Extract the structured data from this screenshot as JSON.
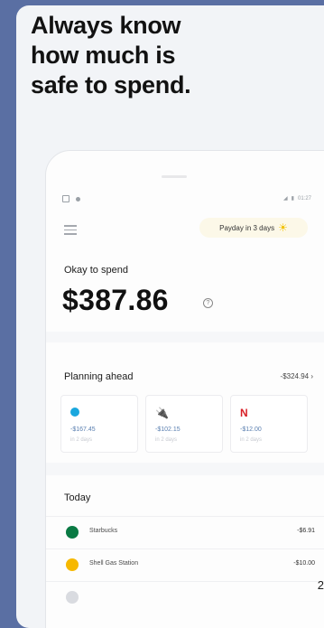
{
  "headline": {
    "line1": "Always know",
    "line2": "how much is",
    "line3": "safe to spend."
  },
  "statusbar": {
    "time": "01:27"
  },
  "payday": {
    "label": "Payday in 3 days"
  },
  "spend": {
    "label": "Okay to spend",
    "amount": "$387.86"
  },
  "planning": {
    "label": "Planning ahead",
    "total": "-$324.94 ›",
    "tiles": [
      {
        "icon": "att-icon",
        "amount": "-$167.45",
        "when": "in 2 days"
      },
      {
        "icon": "plug-icon",
        "amount": "-$102.15",
        "when": "in 2 days"
      },
      {
        "icon": "netflix-icon",
        "amount": "-$12.00",
        "when": "in 2 days"
      }
    ]
  },
  "today": {
    "label": "Today",
    "transactions": [
      {
        "name": "Starbucks",
        "amount": "-$6.91",
        "color": "#0a7a44"
      },
      {
        "name": "Shell Gas Station",
        "amount": "-$10.00",
        "color": "#f6b800"
      }
    ]
  },
  "page_number": "2",
  "colors": {
    "background": "#5a6fa3",
    "accent_text": "#5a7fb0",
    "sun": "#f2c200",
    "netflix": "#d81f26"
  }
}
